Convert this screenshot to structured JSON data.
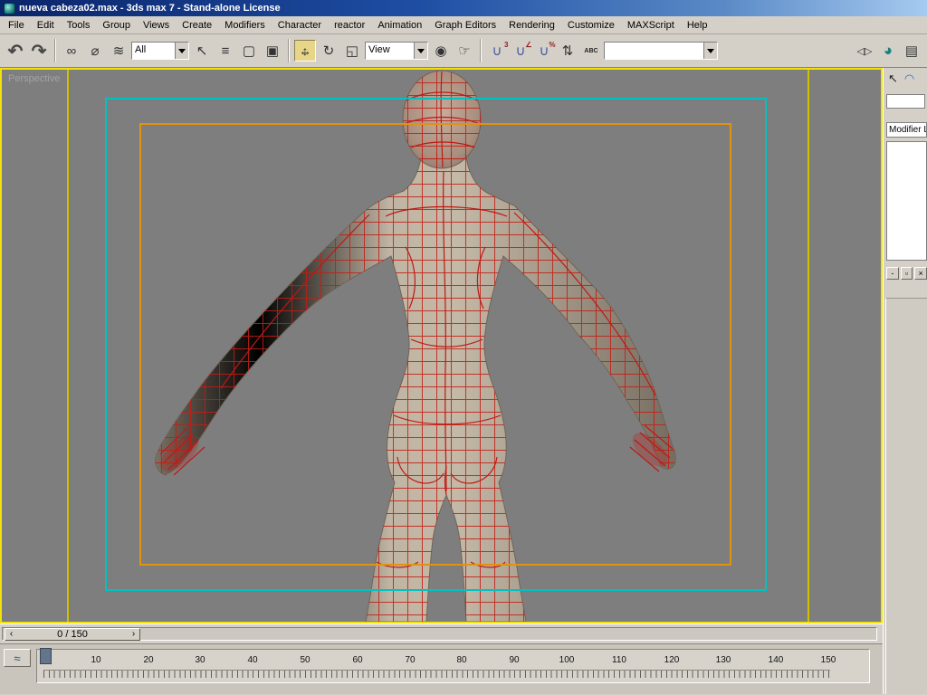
{
  "window": {
    "title": "nueva cabeza02.max - 3ds max 7  - Stand-alone License"
  },
  "menubar": {
    "items": [
      "File",
      "Edit",
      "Tools",
      "Group",
      "Views",
      "Create",
      "Modifiers",
      "Character",
      "reactor",
      "Animation",
      "Graph Editors",
      "Rendering",
      "Customize",
      "MAXScript",
      "Help"
    ]
  },
  "toolbar": {
    "selection_filter_value": "All",
    "coord_system_value": "View",
    "named_sets_value": "",
    "icons": {
      "undo": "↶",
      "redo": "↷",
      "select_and_link": "∞",
      "unlink": "⌀",
      "bind_spacewarp": "≋",
      "select_object": "↖",
      "select_by_name": "≡",
      "rect_region": "▢",
      "window_crossing": "▣",
      "move_h": "↔",
      "move_v": "↕",
      "rotate": "↻",
      "scale": "◱",
      "pivot_center": "◉",
      "manipulate": "☞",
      "magnet": "∪",
      "snap3_label": "3",
      "angle_label": "∠",
      "percent_label": "%",
      "spinner_snap": "⇅",
      "named_sets": "ABC",
      "mirror": "◁▷",
      "material_editor": "◕",
      "render_scene": "▤"
    }
  },
  "viewport": {
    "label": "Perspective"
  },
  "command_panel": {
    "tabs": {
      "create_icon": "↖",
      "modify_icon": "◠"
    },
    "name_field_value": "",
    "modifier_list_label": "Modifier L",
    "buttons": [
      {
        "glyph": "-"
      },
      {
        "glyph": "▫"
      },
      {
        "glyph": "×"
      }
    ]
  },
  "timeline": {
    "prev_arrow": "‹",
    "frame_display": "0 / 150",
    "next_arrow": "›"
  },
  "trackbar": {
    "mini_curve_editor_icon": "≈",
    "tick_labels": [
      "0",
      "10",
      "20",
      "30",
      "40",
      "50",
      "60",
      "70",
      "80",
      "90",
      "100",
      "110",
      "120",
      "130",
      "140",
      "150"
    ]
  },
  "colors": {
    "active_viewport_border": "#f0e20a",
    "safe_frame_live": "#cfc000",
    "safe_frame_action": "#00c2c2",
    "safe_frame_title": "#e09310",
    "wireframe": "#c41c14",
    "viewport_background": "#7e7e7e"
  }
}
